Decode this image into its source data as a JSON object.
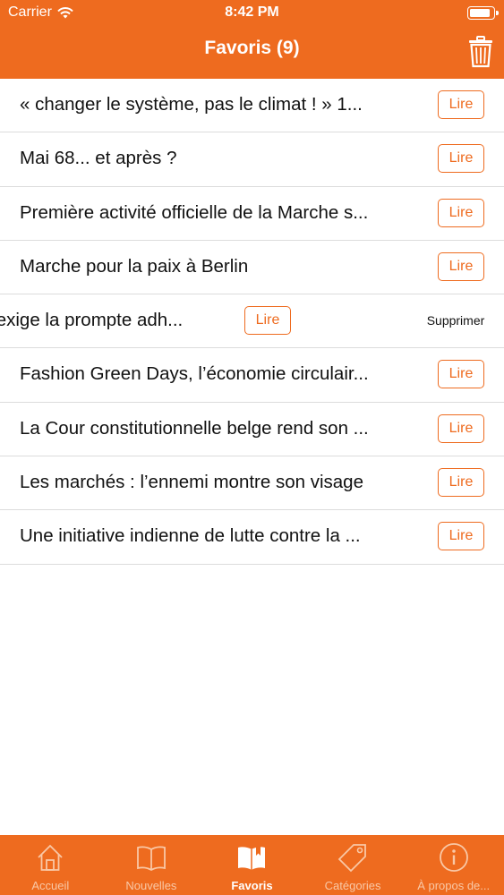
{
  "status_bar": {
    "carrier": "Carrier",
    "time": "8:42 PM"
  },
  "nav": {
    "title": "Favoris (9)"
  },
  "favorites": [
    {
      "title": "« changer le système, pas le climat ! » 1...",
      "read_label": "Lire"
    },
    {
      "title": "Mai 68... et après ?",
      "read_label": "Lire"
    },
    {
      "title": "Première activité officielle de la Marche s...",
      "read_label": "Lire"
    },
    {
      "title": "Marche pour la paix à Berlin",
      "read_label": "Lire"
    },
    {
      "title": "eil national exige la prompte adh...",
      "read_label": "Lire",
      "delete_label": "Supprimer",
      "swiped": true
    },
    {
      "title": "Fashion Green Days, l’économie circulair...",
      "read_label": "Lire"
    },
    {
      "title": "La Cour constitutionnelle belge rend son ...",
      "read_label": "Lire"
    },
    {
      "title": "Les marchés : l’ennemi montre son visage",
      "read_label": "Lire"
    },
    {
      "title": "Une initiative indienne de lutte contre la ...",
      "read_label": "Lire"
    }
  ],
  "tabs": [
    {
      "label": "Accueil",
      "icon": "home-icon",
      "active": false
    },
    {
      "label": "Nouvelles",
      "icon": "book-icon",
      "active": false
    },
    {
      "label": "Favoris",
      "icon": "bookmark-book-icon",
      "active": true
    },
    {
      "label": "Catégories",
      "icon": "tag-icon",
      "active": false
    },
    {
      "label": "À propos de...",
      "icon": "info-icon",
      "active": false
    }
  ],
  "colors": {
    "accent": "#ee6b1f",
    "tab_inactive": "#f9c8a6",
    "separator": "#dcdcdc"
  }
}
